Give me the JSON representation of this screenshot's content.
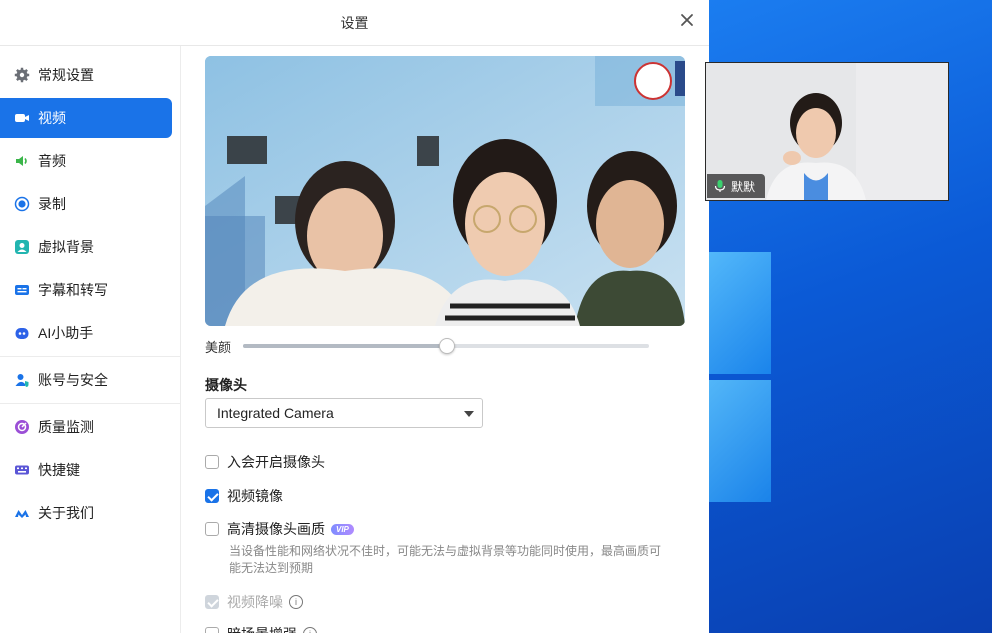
{
  "window": {
    "title": "设置"
  },
  "sidebar": {
    "items": [
      {
        "label": "常规设置",
        "icon": "gear-icon"
      },
      {
        "label": "视频",
        "icon": "video-camera-icon",
        "active": true
      },
      {
        "label": "音频",
        "icon": "speaker-icon"
      },
      {
        "label": "录制",
        "icon": "record-icon"
      },
      {
        "label": "虚拟背景",
        "icon": "virtual-background-icon"
      },
      {
        "label": "字幕和转写",
        "icon": "captions-icon"
      },
      {
        "label": "AI小助手",
        "icon": "ai-assistant-icon"
      },
      {
        "label": "账号与安全",
        "icon": "account-security-icon"
      },
      {
        "label": "质量监测",
        "icon": "quality-monitor-icon"
      },
      {
        "label": "快捷键",
        "icon": "keyboard-icon"
      },
      {
        "label": "关于我们",
        "icon": "about-logo-icon"
      }
    ]
  },
  "video": {
    "beauty_label": "美颜",
    "beauty_level": 0.5,
    "camera_label": "摄像头",
    "camera_value": "Integrated Camera",
    "options": [
      {
        "label": "入会开启摄像头",
        "checked": false
      },
      {
        "label": "视频镜像",
        "checked": true
      },
      {
        "label": "高清摄像头画质",
        "checked": false,
        "badge": "VIP"
      }
    ],
    "hd_hint": "当设备性能和网络状况不佳时，可能无法与虚拟背景等功能同时使用，最高画质可能无法达到预期",
    "denoise_label": "视频降噪",
    "partial_label": "暗场景增强"
  },
  "meeting": {
    "participant_name": "默默"
  },
  "colors": {
    "accent": "#1a73e8",
    "desktop": "#0b5ad6"
  }
}
